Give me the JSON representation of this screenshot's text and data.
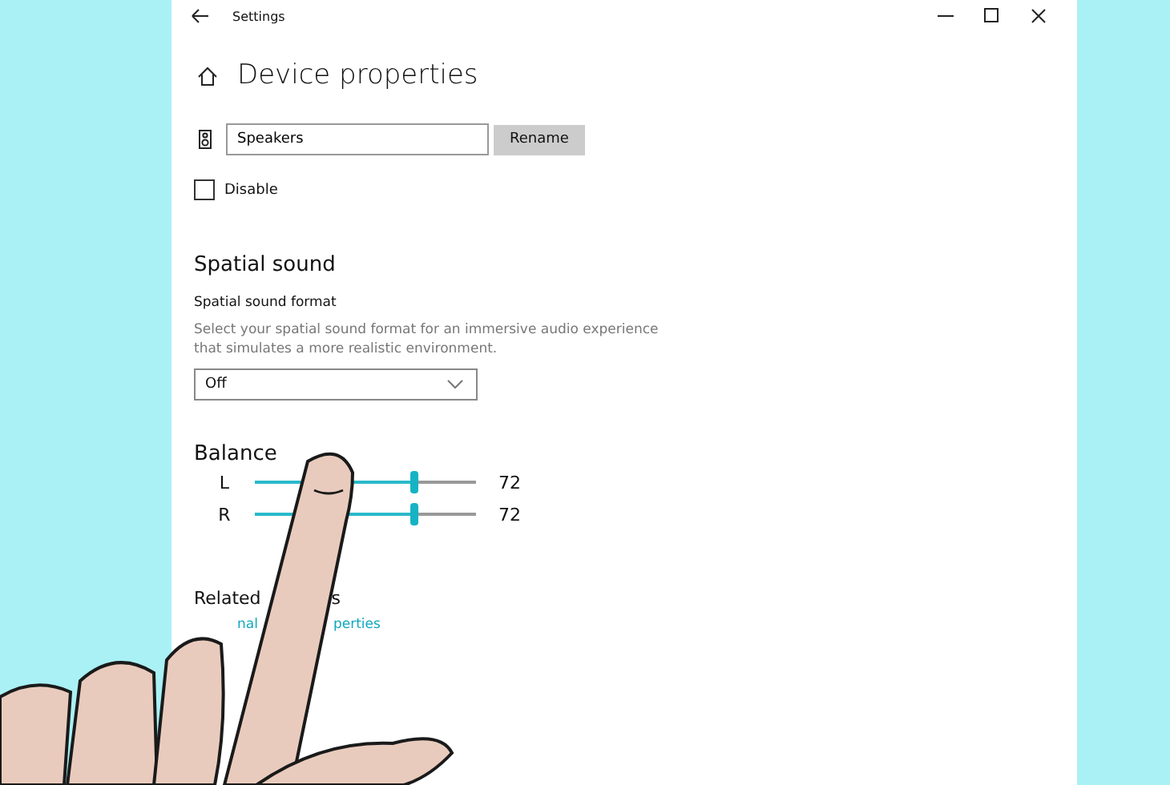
{
  "window": {
    "title": "Settings"
  },
  "page": {
    "title": "Device properties"
  },
  "device": {
    "name": "Speakers",
    "rename_button": "Rename"
  },
  "disable": {
    "label": "Disable",
    "checked": false
  },
  "spatial_sound": {
    "heading": "Spatial sound",
    "label": "Spatial sound format",
    "description": "Select your spatial sound format for an immersive audio experience that simulates a more realistic environment.",
    "dropdown": {
      "value": "Off"
    }
  },
  "balance": {
    "heading": "Balance",
    "channels": [
      {
        "name": "L",
        "level": 0.72,
        "reading": "72"
      },
      {
        "name": "R",
        "level": 0.72,
        "reading": "72"
      }
    ]
  },
  "related": {
    "heading_parts": [
      "Related",
      "s"
    ],
    "link_parts": [
      "nal",
      "perties"
    ]
  }
}
